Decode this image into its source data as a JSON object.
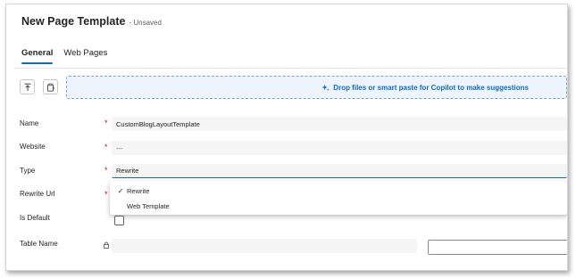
{
  "header": {
    "title": "New Page Template",
    "status": "- Unsaved"
  },
  "tabs": [
    {
      "label": "General"
    },
    {
      "label": "Web Pages"
    }
  ],
  "toolbar": {
    "dropzone_text": "Drop files or smart paste for Copilot to make suggestions"
  },
  "form": {
    "name": {
      "label": "Name",
      "value": "CustomBlogLayoutTemplate"
    },
    "website": {
      "label": "Website",
      "value": "---"
    },
    "type": {
      "label": "Type",
      "value": "Rewrite"
    },
    "rewrite_url": {
      "label": "Rewrite Url"
    },
    "is_default": {
      "label": "Is Default"
    },
    "table_name": {
      "label": "Table Name"
    },
    "required_marker": "*"
  },
  "type_dropdown": {
    "options": [
      {
        "label": "Rewrite",
        "selected": true,
        "check": "✓"
      },
      {
        "label": "Web Template",
        "selected": false
      }
    ]
  },
  "colors": {
    "accent": "#0f6cbd",
    "required": "#c50f1f"
  }
}
